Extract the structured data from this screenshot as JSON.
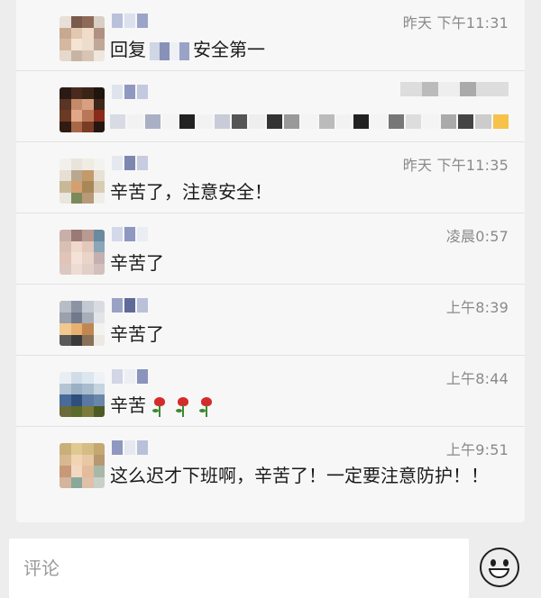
{
  "comments": [
    {
      "time": "昨天 下午11:31",
      "text_before": "回复",
      "text_after": "安全第一"
    },
    {
      "time": ""
    },
    {
      "time": "昨天 下午11:35",
      "text": "辛苦了，注意安全！"
    },
    {
      "time": "凌晨0:57",
      "text": "辛苦了"
    },
    {
      "time": "上午8:39",
      "text": "辛苦了"
    },
    {
      "time": "上午8:44",
      "text": "辛苦"
    },
    {
      "time": "上午9:51",
      "text": "这么迟才下班啊，辛苦了！一定要注意防护！！"
    }
  ],
  "comment_bar": {
    "placeholder": "评论",
    "emoji_icon": "smiley-face-icon"
  }
}
